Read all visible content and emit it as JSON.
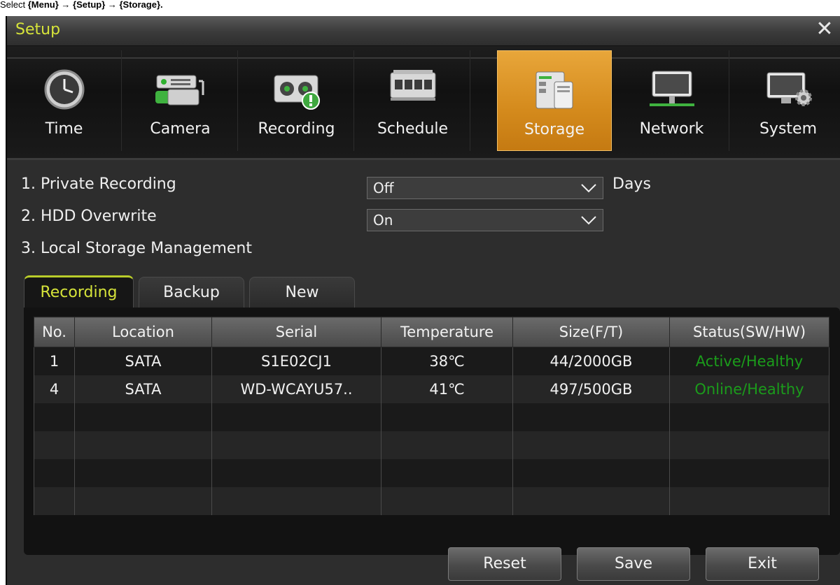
{
  "caption": {
    "prefix": "Select ",
    "path": "{Menu} → {Setup} → {Storage}.",
    "path_label": "{Menu} → {Setup} → {Storage}."
  },
  "window": {
    "title": "Setup"
  },
  "menu": {
    "tabs": [
      {
        "label": "Time",
        "icon": "clock-icon",
        "active": false
      },
      {
        "label": "Camera",
        "icon": "camera-icon",
        "active": false
      },
      {
        "label": "Recording",
        "icon": "recording-icon",
        "active": false
      },
      {
        "label": "Schedule",
        "icon": "schedule-icon",
        "active": false
      },
      {
        "label": "Storage",
        "icon": "storage-icon",
        "active": true
      },
      {
        "label": "Network",
        "icon": "network-icon",
        "active": false
      },
      {
        "label": "System",
        "icon": "system-icon",
        "active": false
      }
    ]
  },
  "settings": {
    "private_recording": {
      "label": "1. Private Recording",
      "value": "Off",
      "unit": "Days"
    },
    "hdd_overwrite": {
      "label": "2. HDD Overwrite",
      "value": "On"
    },
    "local_storage": {
      "label": "3. Local Storage Management"
    }
  },
  "subtabs": [
    {
      "label": "Recording",
      "active": true
    },
    {
      "label": "Backup",
      "active": false
    },
    {
      "label": "New",
      "active": false
    }
  ],
  "table": {
    "columns": [
      "No.",
      "Location",
      "Serial",
      "Temperature",
      "Size(F/T)",
      "Status(SW/HW)"
    ],
    "rows": [
      {
        "no": "1",
        "location": "SATA",
        "serial": "S1E02CJ1",
        "temperature": "38℃",
        "size": "44/2000GB",
        "status": "Active/Healthy"
      },
      {
        "no": "4",
        "location": "SATA",
        "serial": "WD-WCAYU57..",
        "temperature": "41℃",
        "size": "497/500GB",
        "status": "Online/Healthy"
      }
    ]
  },
  "buttons": {
    "reset": "Reset",
    "save": "Save",
    "exit": "Exit"
  },
  "colors": {
    "accent_active_tab": "#d48a1c",
    "title_text": "#d6e43a",
    "status_green": "#1b9c1b"
  }
}
